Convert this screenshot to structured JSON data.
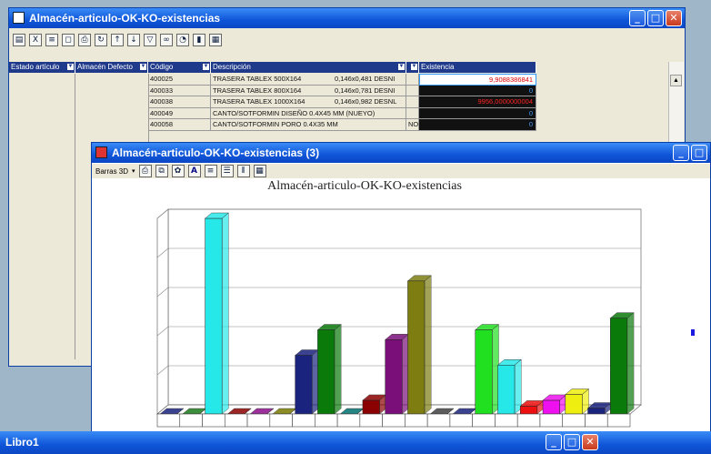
{
  "main_window": {
    "title": "Almacén-articulo-OK-KO-existencias",
    "grid": {
      "headers": [
        "Estado artículo",
        "Almacén Defecto",
        "Código",
        "Descripción",
        "",
        "Existencia"
      ],
      "rows": [
        {
          "code": "400025",
          "desc": "TRASERA TABLEX 500X164",
          "dims": "0,146x0,481 DESNI",
          "flag": "",
          "exist": "9,9088386841",
          "style": "sel"
        },
        {
          "code": "400033",
          "desc": "TRASERA TABLEX 800X164",
          "dims": "0,146x0,781 DESNI",
          "flag": "",
          "exist": "0",
          "style": ""
        },
        {
          "code": "400038",
          "desc": "TRASERA TABLEX 1000X164",
          "dims": "0,146x0,982 DESNL",
          "flag": "",
          "exist": "9956,0000000004",
          "style": "red"
        },
        {
          "code": "400049",
          "desc": "CANTO/SOTFORMIN DISEÑO 0.4X45 MM (NUEYO)",
          "dims": "",
          "flag": "",
          "exist": "0",
          "style": ""
        },
        {
          "code": "400058",
          "desc": "CANTO/SOTFORMIN PORO 0.4X35 MM",
          "dims": "",
          "flag": "NO",
          "exist": "0",
          "style": ""
        }
      ]
    }
  },
  "chart_window": {
    "title": "Almacén-articulo-OK-KO-existencias (3)",
    "toolbar": {
      "chart_type_label": "Barras 3D"
    },
    "chart_title": "Almacén-articulo-OK-KO-existencias"
  },
  "chart_data": {
    "type": "bar",
    "title": "Almacén-articulo-OK-KO-existencias",
    "ylim": [
      0,
      10000
    ],
    "grid": true,
    "legend": "right",
    "values": [
      0,
      0,
      10000,
      0,
      0,
      0,
      3000,
      4300,
      0,
      700,
      3800,
      6800,
      0,
      0,
      4300,
      2500,
      400,
      700,
      1000,
      300,
      4900
    ],
    "colors": [
      "#1a237e",
      "#1b7a1b",
      "#27e8e8",
      "#8b0000",
      "#8b0e8b",
      "#7a7a00",
      "#1a237e",
      "#0a7a0a",
      "#007070",
      "#8b0000",
      "#7a0f7a",
      "#7d7d12",
      "#404040",
      "#1a237e",
      "#20e020",
      "#27e8e8",
      "#ee1010",
      "#ee10ee",
      "#eeee10",
      "#1a237e",
      "#0a7a0a"
    ]
  },
  "taskbar": {
    "title": "Libro1"
  },
  "colors": {
    "titlebar": "#0f55d8",
    "grid_header": "#1f3a8a",
    "existencia_cell": "#111111"
  }
}
